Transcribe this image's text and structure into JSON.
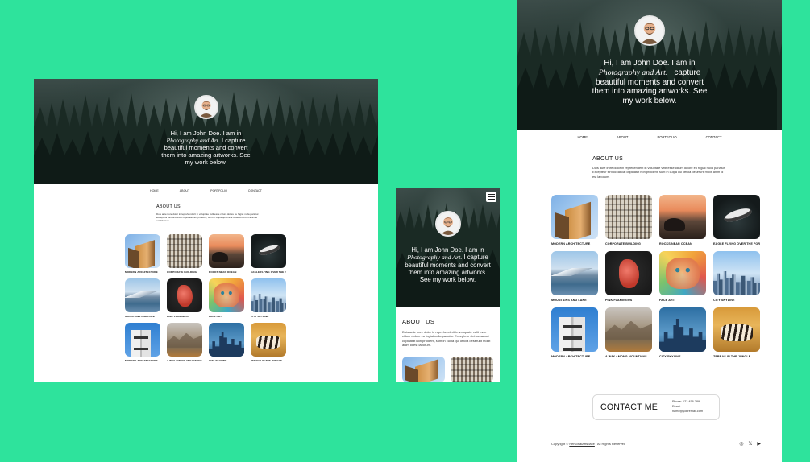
{
  "brand": {
    "background": "#2ee39c",
    "text_dark": "#111111",
    "hero_dark": "#1b2a25"
  },
  "hero": {
    "intro_before": "Hi, I am John Doe. I am in",
    "intro_emph": "Photography and Art.",
    "intro_after": "I capture beautiful moments and convert them into amazing artworks. See my work below.",
    "avatar_icon": "avatar-portrait-icon",
    "menu_icon": "hamburger-menu-icon"
  },
  "nav": {
    "home": "HOME",
    "about": "ABOUT",
    "portfolio": "PORTFOLIO",
    "contact": "CONTACT"
  },
  "about": {
    "title": "ABOUT US",
    "text": "Duis aute irure dolor in reprehenderit in voluptate velit esse cillum dolore eu fugiat nulla pariatur. Excepteur sint occaecat cupidatat non proident, sunt in culpa qui officia deserunt mollit anim id est laborum."
  },
  "gallery": [
    {
      "caption": "MODERN ARCHITECTURE",
      "art": "a-arch"
    },
    {
      "caption": "CORPORATE BUILDING",
      "art": "a-corp"
    },
    {
      "caption": "ROCKS NEAR OCEAN",
      "art": "a-rocks"
    },
    {
      "caption": "EAGLE FLYING OVER THE FOREST",
      "art": "a-eagle"
    },
    {
      "caption": "MOUNTAINS AND LAKE",
      "art": "a-mount"
    },
    {
      "caption": "PINK FLAMINGOS",
      "art": "a-flam"
    },
    {
      "caption": "FACE ART",
      "art": "a-face"
    },
    {
      "caption": "CITY SKYLINE",
      "art": "a-sky"
    },
    {
      "caption": "MODERN ARCHITECTURE",
      "art": "a-modern"
    },
    {
      "caption": "A WAY AMONG MOUNTAINS",
      "art": "a-valley"
    },
    {
      "caption": "CITY SKYLINE",
      "art": "a-city"
    },
    {
      "caption": "ZEBRAS IN THE JUNGLE",
      "art": "a-zebra"
    }
  ],
  "contact": {
    "title": "CONTACT ME",
    "phone": "Phone: 123 456 789",
    "email": "Email: name@youremail.com"
  },
  "footer": {
    "copyright_prefix": "Copyright ©",
    "copyright_link": "PersonalArtspace",
    "copyright_suffix": "| All Rights Reserved",
    "social_instagram": "◎",
    "social_x": "𝕏",
    "social_youtube": "▶"
  }
}
